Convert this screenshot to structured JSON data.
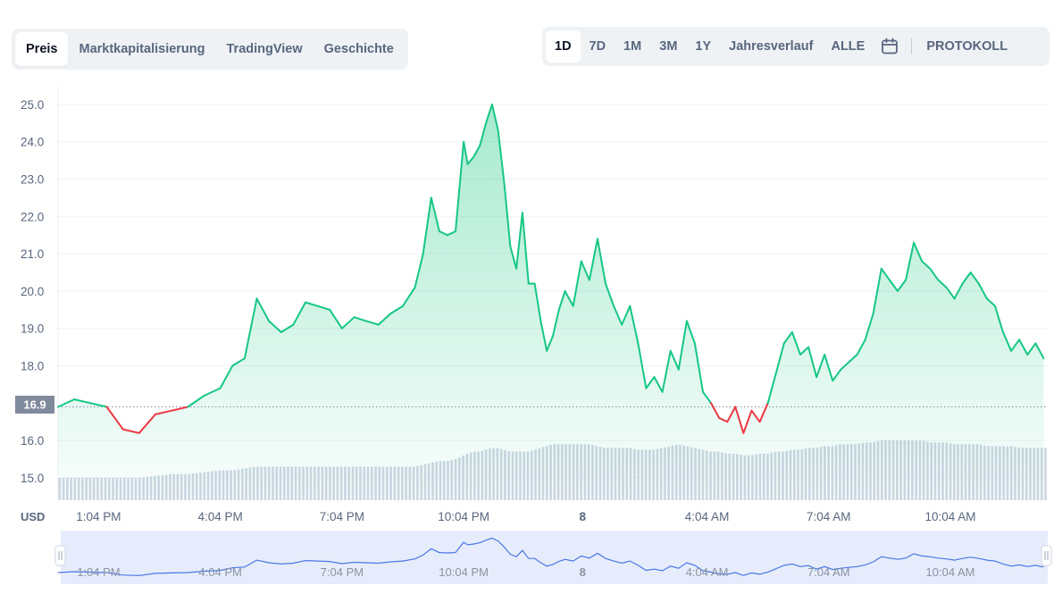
{
  "tabs": [
    {
      "label": "Preis",
      "active": true
    },
    {
      "label": "Marktkapitalisierung",
      "active": false
    },
    {
      "label": "TradingView",
      "active": false
    },
    {
      "label": "Geschichte",
      "active": false
    }
  ],
  "ranges": [
    {
      "label": "1D",
      "active": true
    },
    {
      "label": "7D",
      "active": false
    },
    {
      "label": "1M",
      "active": false
    },
    {
      "label": "3M",
      "active": false
    },
    {
      "label": "1Y",
      "active": false
    },
    {
      "label": "Jahresverlauf",
      "active": false
    },
    {
      "label": "ALLE",
      "active": false
    }
  ],
  "calendar_icon": "calendar-icon",
  "log_label": "PROTOKOLL",
  "colors": {
    "up": "#16c784",
    "down": "#ea3943",
    "volume": "#cfd6e4",
    "navigator_line": "#4a78e6",
    "navigator_fill": "#e6ecfb",
    "badge": "#808a9d"
  },
  "chart_data": {
    "type": "line",
    "ylabel": "USD",
    "yticks": [
      "15.0",
      "16.0",
      "18.0",
      "19.0",
      "20.0",
      "21.0",
      "22.0",
      "23.0",
      "24.0",
      "25.0"
    ],
    "ylim": [
      14.4,
      25.5
    ],
    "xticks": [
      "1:04 PM",
      "4:04 PM",
      "7:04 PM",
      "10:04 PM",
      "8",
      "4:04 AM",
      "7:04 AM",
      "10:04 AM"
    ],
    "xtick_positions": [
      1,
      4,
      7,
      10,
      12.933,
      16,
      19,
      22
    ],
    "xlim": [
      0,
      24.4
    ],
    "baseline": 16.9,
    "baseline_label": "16.9",
    "grid": true,
    "x": [
      0,
      0.4,
      0.8,
      1.2,
      1.6,
      2,
      2.4,
      2.8,
      3.2,
      3.6,
      4,
      4.3,
      4.6,
      4.9,
      5.2,
      5.5,
      5.8,
      6.1,
      6.4,
      6.7,
      7,
      7.3,
      7.6,
      7.9,
      8.2,
      8.5,
      8.8,
      9.0,
      9.2,
      9.4,
      9.6,
      9.8,
      10.0,
      10.1,
      10.25,
      10.4,
      10.55,
      10.7,
      10.85,
      11.0,
      11.15,
      11.3,
      11.45,
      11.6,
      11.75,
      11.9,
      12.05,
      12.2,
      12.35,
      12.5,
      12.7,
      12.9,
      13.1,
      13.3,
      13.5,
      13.7,
      13.9,
      14.1,
      14.3,
      14.5,
      14.7,
      14.9,
      15.1,
      15.3,
      15.5,
      15.7,
      15.9,
      16.1,
      16.3,
      16.5,
      16.7,
      16.9,
      17.1,
      17.3,
      17.5,
      17.7,
      17.9,
      18.1,
      18.3,
      18.5,
      18.7,
      18.9,
      19.1,
      19.3,
      19.5,
      19.7,
      19.9,
      20.1,
      20.3,
      20.5,
      20.7,
      20.9,
      21.1,
      21.3,
      21.5,
      21.7,
      21.9,
      22.1,
      22.3,
      22.5,
      22.7,
      22.9,
      23.1,
      23.3,
      23.5,
      23.7,
      23.9,
      24.1,
      24.3
    ],
    "values": [
      16.9,
      17.1,
      17.0,
      16.9,
      16.3,
      16.2,
      16.7,
      16.8,
      16.9,
      17.2,
      17.4,
      18.0,
      18.2,
      19.8,
      19.2,
      18.9,
      19.1,
      19.7,
      19.6,
      19.5,
      19.0,
      19.3,
      19.2,
      19.1,
      19.4,
      19.6,
      20.1,
      21.0,
      22.5,
      21.6,
      21.5,
      21.6,
      24.0,
      23.4,
      23.6,
      23.9,
      24.5,
      25.0,
      24.3,
      22.9,
      21.2,
      20.6,
      22.1,
      20.2,
      20.2,
      19.2,
      18.4,
      18.8,
      19.5,
      20.0,
      19.6,
      20.8,
      20.3,
      21.4,
      20.2,
      19.6,
      19.1,
      19.6,
      18.6,
      17.4,
      17.7,
      17.3,
      18.4,
      17.9,
      19.2,
      18.6,
      17.3,
      17.0,
      16.6,
      16.5,
      16.9,
      16.2,
      16.8,
      16.5,
      17.0,
      17.8,
      18.6,
      18.9,
      18.3,
      18.5,
      17.7,
      18.3,
      17.6,
      17.9,
      18.1,
      18.3,
      18.7,
      19.4,
      20.6,
      20.3,
      20.0,
      20.3,
      21.3,
      20.8,
      20.6,
      20.3,
      20.1,
      19.8,
      20.2,
      20.5,
      20.2,
      19.8,
      19.6,
      18.9,
      18.4,
      18.7,
      18.3,
      18.6,
      18.2
    ],
    "volume": [
      15.0,
      15.0,
      15.0,
      15.0,
      15.0,
      15.0,
      15.05,
      15.1,
      15.1,
      15.15,
      15.2,
      15.2,
      15.25,
      15.3,
      15.3,
      15.3,
      15.3,
      15.3,
      15.3,
      15.3,
      15.3,
      15.3,
      15.3,
      15.3,
      15.3,
      15.3,
      15.3,
      15.35,
      15.4,
      15.45,
      15.45,
      15.5,
      15.6,
      15.65,
      15.7,
      15.7,
      15.75,
      15.8,
      15.8,
      15.75,
      15.7,
      15.7,
      15.7,
      15.7,
      15.75,
      15.8,
      15.85,
      15.9,
      15.9,
      15.9,
      15.9,
      15.9,
      15.9,
      15.85,
      15.8,
      15.8,
      15.8,
      15.8,
      15.75,
      15.75,
      15.75,
      15.8,
      15.85,
      15.9,
      15.85,
      15.8,
      15.75,
      15.7,
      15.7,
      15.65,
      15.65,
      15.6,
      15.6,
      15.65,
      15.65,
      15.7,
      15.7,
      15.75,
      15.75,
      15.8,
      15.8,
      15.85,
      15.85,
      15.9,
      15.9,
      15.9,
      15.95,
      15.95,
      16.0,
      16.0,
      16.0,
      16.0,
      16.0,
      16.0,
      15.95,
      15.95,
      15.95,
      15.9,
      15.9,
      15.9,
      15.9,
      15.85,
      15.85,
      15.85,
      15.85,
      15.8,
      15.8,
      15.8,
      15.8
    ]
  }
}
